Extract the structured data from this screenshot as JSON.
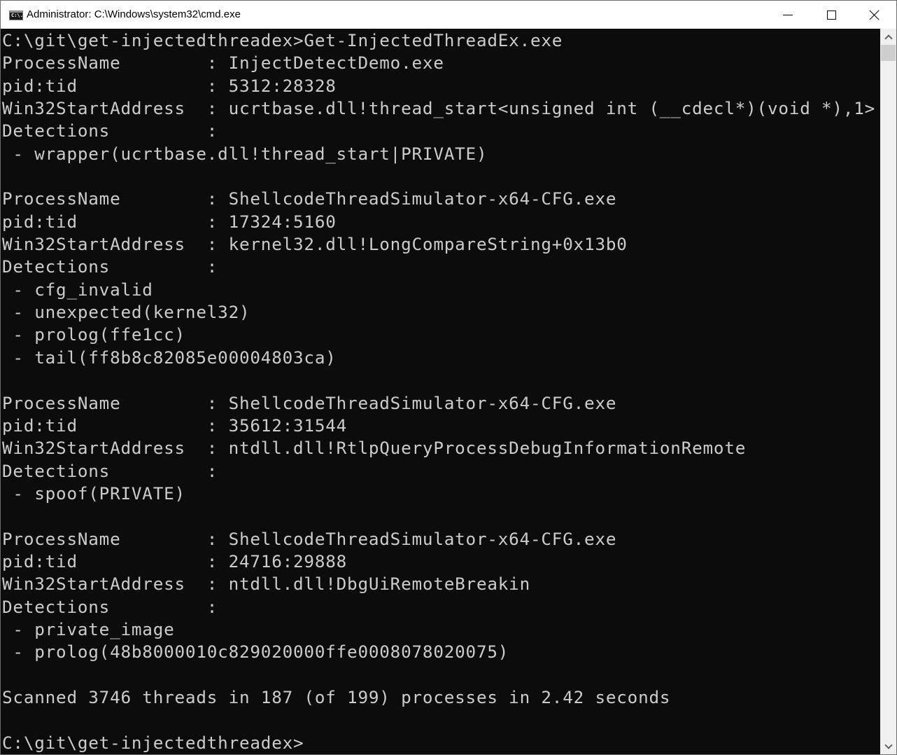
{
  "window": {
    "title": "Administrator: C:\\Windows\\system32\\cmd.exe",
    "icon": "cmd-icon",
    "icon_glyph": "C:\\.",
    "controls": {
      "minimize": "minimize-icon",
      "maximize": "maximize-icon",
      "close": "close-icon"
    }
  },
  "console": {
    "background": "#0c0c0c",
    "foreground": "#cccccc",
    "lines": [
      "C:\\git\\get-injectedthreadex>Get-InjectedThreadEx.exe",
      "ProcessName        : InjectDetectDemo.exe",
      "pid:tid            : 5312:28328",
      "Win32StartAddress  : ucrtbase.dll!thread_start<unsigned int (__cdecl*)(void *),1>",
      "Detections         :",
      " - wrapper(ucrtbase.dll!thread_start|PRIVATE)",
      "",
      "ProcessName        : ShellcodeThreadSimulator-x64-CFG.exe",
      "pid:tid            : 17324:5160",
      "Win32StartAddress  : kernel32.dll!LongCompareString+0x13b0",
      "Detections         :",
      " - cfg_invalid",
      " - unexpected(kernel32)",
      " - prolog(ffe1cc)",
      " - tail(ff8b8c82085e00004803ca)",
      "",
      "ProcessName        : ShellcodeThreadSimulator-x64-CFG.exe",
      "pid:tid            : 35612:31544",
      "Win32StartAddress  : ntdll.dll!RtlpQueryProcessDebugInformationRemote",
      "Detections         :",
      " - spoof(PRIVATE)",
      "",
      "ProcessName        : ShellcodeThreadSimulator-x64-CFG.exe",
      "pid:tid            : 24716:29888",
      "Win32StartAddress  : ntdll.dll!DbgUiRemoteBreakin",
      "Detections         :",
      " - private_image",
      " - prolog(48b8000010c829020000ffe0008078020075)",
      "",
      "Scanned 3746 threads in 187 (of 199) processes in 2.42 seconds",
      "",
      "C:\\git\\get-injectedthreadex>"
    ]
  },
  "scrollbar": {
    "up_icon": "chevron-up-icon",
    "down_icon": "chevron-down-icon",
    "position": "bottom"
  }
}
